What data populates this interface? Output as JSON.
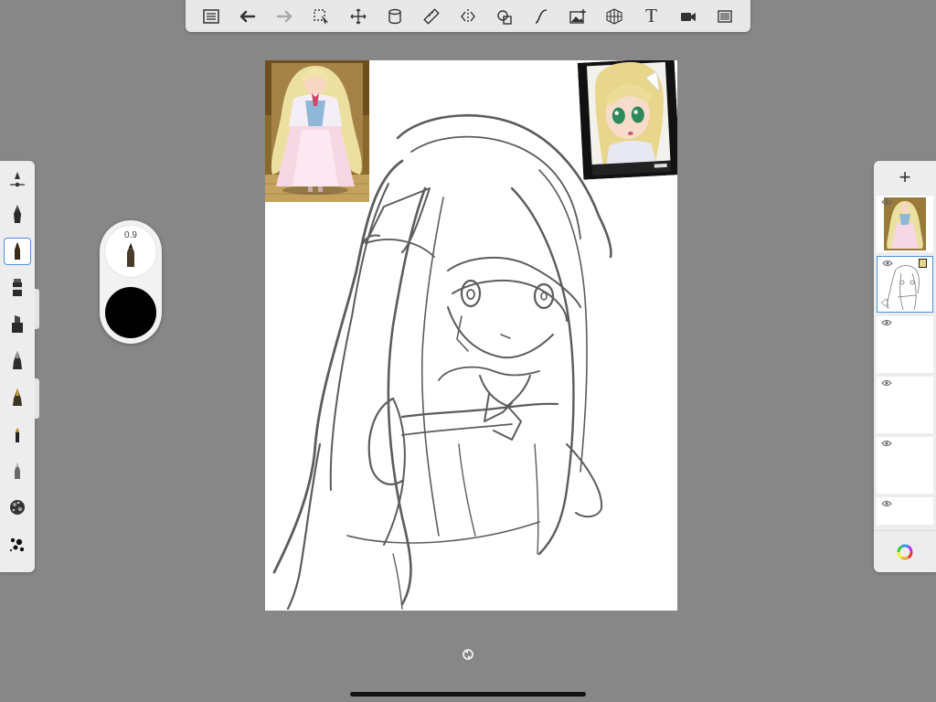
{
  "toolbar": {
    "items": [
      {
        "name": "gallery-list-icon"
      },
      {
        "name": "undo-icon"
      },
      {
        "name": "redo-icon"
      },
      {
        "name": "selection-icon"
      },
      {
        "name": "transform-move-icon"
      },
      {
        "name": "layer-stack-icon"
      },
      {
        "name": "ruler-icon"
      },
      {
        "name": "symmetry-icon"
      },
      {
        "name": "shape-icon"
      },
      {
        "name": "curve-icon"
      },
      {
        "name": "add-image-icon"
      },
      {
        "name": "perspective-grid-icon"
      },
      {
        "name": "text-icon"
      },
      {
        "name": "record-video-icon"
      },
      {
        "name": "fullscreen-icon"
      }
    ],
    "text_glyph": "T"
  },
  "brush_library": {
    "items": [
      {
        "name": "brush-settings-icon"
      },
      {
        "name": "pen-icon"
      },
      {
        "name": "pencil-icon",
        "selected": true
      },
      {
        "name": "marker-icon"
      },
      {
        "name": "chisel-marker-icon"
      },
      {
        "name": "fountain-pen-icon"
      },
      {
        "name": "airbrush-icon"
      },
      {
        "name": "paint-brush-icon"
      },
      {
        "name": "soft-brush-icon"
      },
      {
        "name": "texture-brush-icon"
      },
      {
        "name": "splatter-brush-icon"
      }
    ]
  },
  "brush_puck": {
    "size": "0.9",
    "color": "#000000"
  },
  "layers": {
    "add_label": "+",
    "items": [
      {
        "name": "reference-image-layer",
        "selected": false
      },
      {
        "name": "sketch-layer",
        "selected": true
      },
      {
        "name": "empty-layer",
        "selected": false
      },
      {
        "name": "empty-layer",
        "selected": false
      },
      {
        "name": "empty-layer",
        "selected": false
      },
      {
        "name": "empty-layer",
        "selected": false
      }
    ]
  },
  "colors": {
    "accent": "#4a90e2",
    "background": "#878787",
    "panel": "#ededed"
  }
}
